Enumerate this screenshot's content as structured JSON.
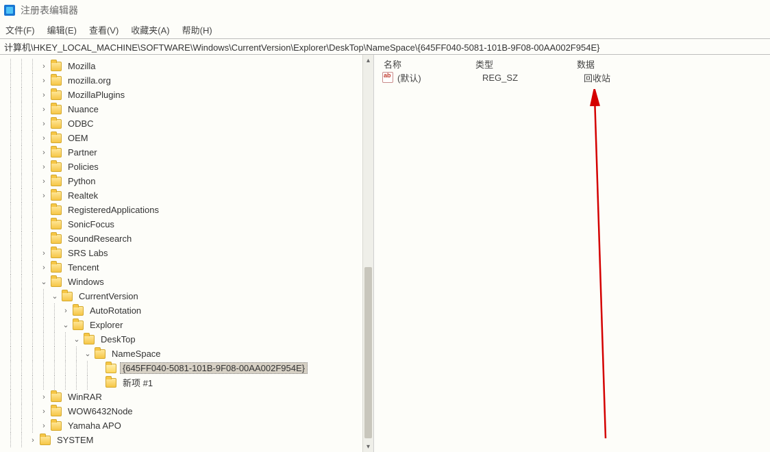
{
  "title": "注册表编辑器",
  "menu": {
    "file": "文件(F)",
    "edit": "编辑(E)",
    "view": "查看(V)",
    "fav": "收藏夹(A)",
    "help": "帮助(H)"
  },
  "address": "计算机\\HKEY_LOCAL_MACHINE\\SOFTWARE\\Windows\\CurrentVersion\\Explorer\\DeskTop\\NameSpace\\{645FF040-5081-101B-9F08-00AA002F954E}",
  "tree": {
    "nodes": [
      {
        "depth": 3,
        "tw": ">",
        "label": "Mozilla"
      },
      {
        "depth": 3,
        "tw": ">",
        "label": "mozilla.org"
      },
      {
        "depth": 3,
        "tw": ">",
        "label": "MozillaPlugins"
      },
      {
        "depth": 3,
        "tw": ">",
        "label": "Nuance"
      },
      {
        "depth": 3,
        "tw": ">",
        "label": "ODBC"
      },
      {
        "depth": 3,
        "tw": ">",
        "label": "OEM"
      },
      {
        "depth": 3,
        "tw": ">",
        "label": "Partner"
      },
      {
        "depth": 3,
        "tw": ">",
        "label": "Policies"
      },
      {
        "depth": 3,
        "tw": ">",
        "label": "Python"
      },
      {
        "depth": 3,
        "tw": ">",
        "label": "Realtek"
      },
      {
        "depth": 3,
        "tw": "",
        "label": "RegisteredApplications"
      },
      {
        "depth": 3,
        "tw": "",
        "label": "SonicFocus"
      },
      {
        "depth": 3,
        "tw": "",
        "label": "SoundResearch"
      },
      {
        "depth": 3,
        "tw": ">",
        "label": "SRS Labs"
      },
      {
        "depth": 3,
        "tw": ">",
        "label": "Tencent"
      },
      {
        "depth": 3,
        "tw": "v",
        "label": "Windows"
      },
      {
        "depth": 4,
        "tw": "v",
        "label": "CurrentVersion"
      },
      {
        "depth": 5,
        "tw": ">",
        "label": "AutoRotation"
      },
      {
        "depth": 5,
        "tw": "v",
        "label": "Explorer"
      },
      {
        "depth": 6,
        "tw": "v",
        "label": "DeskTop"
      },
      {
        "depth": 7,
        "tw": "v",
        "label": "NameSpace"
      },
      {
        "depth": 8,
        "tw": "",
        "label": "{645FF040-5081-101B-9F08-00AA002F954E}",
        "selected": true
      },
      {
        "depth": 8,
        "tw": "",
        "label": "新项 #1"
      },
      {
        "depth": 3,
        "tw": ">",
        "label": "WinRAR"
      },
      {
        "depth": 3,
        "tw": ">",
        "label": "WOW6432Node"
      },
      {
        "depth": 3,
        "tw": ">",
        "label": "Yamaha APO"
      },
      {
        "depth": 2,
        "tw": ">",
        "label": "SYSTEM"
      }
    ]
  },
  "values": {
    "headers": {
      "name": "名称",
      "type": "类型",
      "data": "数据"
    },
    "rows": [
      {
        "name": "(默认)",
        "type": "REG_SZ",
        "data": "回收站"
      }
    ]
  }
}
